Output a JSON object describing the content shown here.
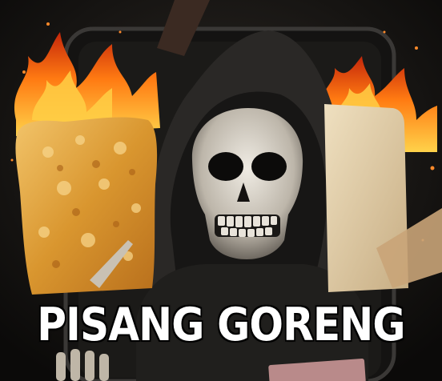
{
  "meme": {
    "caption": "PISANG GORENG"
  },
  "colors": {
    "background": "#0b0a09",
    "flame": "#ff7a12",
    "fritter": "#e0a040",
    "skull": "#d9d4cb",
    "hood": "#2a2826",
    "caption_fill": "#ffffff",
    "caption_stroke": "#000000"
  }
}
